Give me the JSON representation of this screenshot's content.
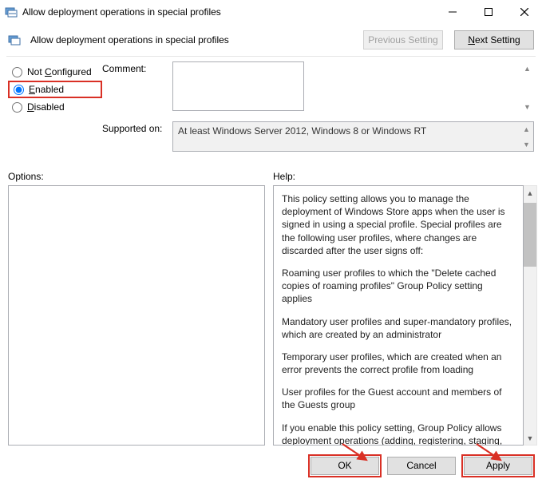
{
  "window": {
    "title": "Allow deployment operations in special profiles"
  },
  "header": {
    "policy_name": "Allow deployment operations in special profiles",
    "prev_label": "Previous Setting",
    "next_label_pre": "N",
    "next_label_rest": "ext Setting"
  },
  "radios": {
    "not_configured_pre": "Not ",
    "not_configured_u": "C",
    "not_configured_rest": "onfigured",
    "enabled_u": "E",
    "enabled_rest": "nabled",
    "disabled_u": "D",
    "disabled_rest": "isabled",
    "selected": "enabled"
  },
  "labels": {
    "comment": "Comment:",
    "supported": "Supported on:",
    "options": "Options:",
    "help": "Help:"
  },
  "comment_value": "",
  "supported_text": "At least Windows Server 2012, Windows 8 or Windows RT",
  "help_paragraphs": [
    "This policy setting allows you to manage the deployment of Windows Store apps when the user is signed in using a special profile. Special profiles are the following user profiles, where changes are discarded after the user signs off:",
    "Roaming user profiles to which the \"Delete cached copies of roaming profiles\" Group Policy setting applies",
    "Mandatory user profiles and super-mandatory profiles, which are created by an administrator",
    "Temporary user profiles, which are created when an error prevents the correct profile from loading",
    "User profiles for the Guest account and members of the Guests group",
    "If you enable this policy setting, Group Policy allows deployment operations (adding, registering, staging, updating, or removing an app package) of Windows Store apps when using a special"
  ],
  "footer": {
    "ok": "OK",
    "cancel": "Cancel",
    "apply": "Apply"
  }
}
